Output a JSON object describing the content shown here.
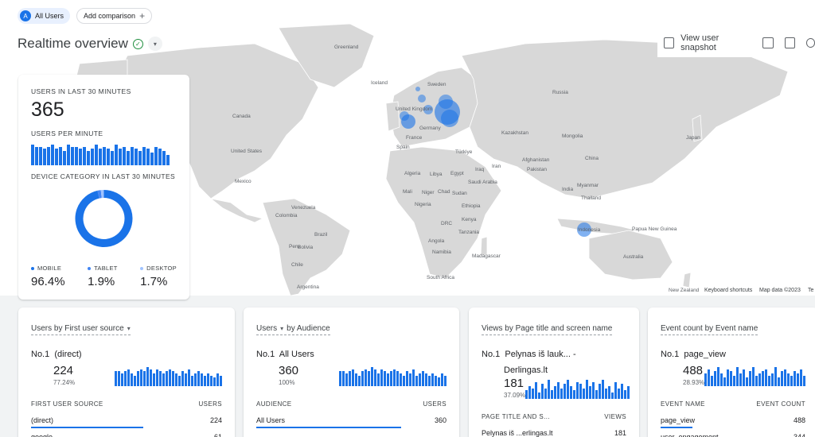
{
  "segment": {
    "badge": "A",
    "label": "All Users",
    "add_label": "Add comparison"
  },
  "header": {
    "title": "Realtime overview",
    "snapshot_label": "View user snapshot"
  },
  "map": {
    "labels": [
      {
        "text": "Greenland"
      },
      {
        "text": "Iceland"
      },
      {
        "text": "Sweden"
      },
      {
        "text": "Russia"
      },
      {
        "text": "United Kingdom"
      },
      {
        "text": "Germany"
      },
      {
        "text": "France"
      },
      {
        "text": "Spain"
      },
      {
        "text": "Kazakhstan"
      },
      {
        "text": "Türkiye"
      },
      {
        "text": "Mongolia"
      },
      {
        "text": "China"
      },
      {
        "text": "Canada"
      },
      {
        "text": "United States"
      },
      {
        "text": "Mexico"
      },
      {
        "text": "Algeria"
      },
      {
        "text": "Libya"
      },
      {
        "text": "Egypt"
      },
      {
        "text": "Mali"
      },
      {
        "text": "Niger"
      },
      {
        "text": "Chad"
      },
      {
        "text": "Sudan"
      },
      {
        "text": "Nigeria"
      },
      {
        "text": "Ethiopia"
      },
      {
        "text": "DRC"
      },
      {
        "text": "Kenya"
      },
      {
        "text": "Tanzania"
      },
      {
        "text": "Angola"
      },
      {
        "text": "Namibia"
      },
      {
        "text": "Madagascar"
      },
      {
        "text": "South Africa"
      },
      {
        "text": "Saudi Arabia"
      },
      {
        "text": "Iran"
      },
      {
        "text": "Iraq"
      },
      {
        "text": "Pakistan"
      },
      {
        "text": "India"
      },
      {
        "text": "Thailand"
      },
      {
        "text": "Indonesia"
      },
      {
        "text": "Papua New Guinea"
      },
      {
        "text": "Australia"
      },
      {
        "text": "New Zealand"
      },
      {
        "text": "Venezuela"
      },
      {
        "text": "Colombia"
      },
      {
        "text": "Peru"
      },
      {
        "text": "Brazil"
      },
      {
        "text": "Bolivia"
      },
      {
        "text": "Chile"
      },
      {
        "text": "Argentina"
      },
      {
        "text": "Japan"
      },
      {
        "text": "Afghanistan"
      },
      {
        "text": "Myanmar"
      }
    ],
    "footer": {
      "shortcuts": "Keyboard shortcuts",
      "data": "Map data ©2023",
      "terms": "Te"
    }
  },
  "overview": {
    "users_caption": "USERS IN LAST 30 MINUTES",
    "users_value": "365",
    "per_minute_caption": "USERS PER MINUTE",
    "per_minute": [
      10,
      9,
      9,
      8,
      9,
      10,
      8,
      9,
      7,
      10,
      9,
      9,
      8,
      9,
      7,
      8,
      10,
      8,
      9,
      8,
      7,
      10,
      8,
      9,
      7,
      9,
      8,
      7,
      9,
      8,
      6,
      9,
      8,
      7,
      5
    ],
    "device_caption": "DEVICE CATEGORY IN LAST 30 MINUTES",
    "devices": [
      {
        "label": "MOBILE",
        "value": "96.4%",
        "fraction": 0.964,
        "color": "#1a73e8"
      },
      {
        "label": "TABLET",
        "value": "1.9%",
        "fraction": 0.019,
        "color": "#4285f4"
      },
      {
        "label": "DESKTOP",
        "value": "1.7%",
        "fraction": 0.017,
        "color": "#a0c3ff"
      }
    ]
  },
  "cards": [
    {
      "title": "Users by First user source",
      "has_dropdown": true,
      "no1_prefix": "No.1",
      "no1_name": "(direct)",
      "value": "224",
      "pct": "77.24%",
      "bars": [
        7,
        7,
        6,
        7,
        8,
        6,
        5,
        7,
        8,
        7,
        9,
        8,
        6,
        8,
        7,
        6,
        7,
        8,
        7,
        6,
        5,
        7,
        6,
        8,
        5,
        6,
        7,
        6,
        5,
        6,
        5,
        4,
        6,
        5
      ],
      "col1": "FIRST USER SOURCE",
      "col2": "USERS",
      "rows": [
        {
          "name": "(direct)",
          "value": "224",
          "share": 0.772
        },
        {
          "name": "google",
          "value": "61",
          "share": 0.21
        }
      ]
    },
    {
      "title": "Users",
      "suffix": "by Audience",
      "has_dropdown": true,
      "no1_prefix": "No.1",
      "no1_name": "All Users",
      "value": "360",
      "pct": "100%",
      "bars": [
        7,
        7,
        6,
        7,
        8,
        6,
        5,
        7,
        8,
        7,
        9,
        8,
        6,
        8,
        7,
        6,
        7,
        8,
        7,
        6,
        5,
        7,
        6,
        8,
        5,
        6,
        7,
        6,
        5,
        6,
        5,
        4,
        6,
        5
      ],
      "col1": "AUDIENCE",
      "col2": "USERS",
      "rows": [
        {
          "name": "All Users",
          "value": "360",
          "share": 1.0
        }
      ]
    },
    {
      "title": "Views by Page title and screen name",
      "has_dropdown": false,
      "no1_prefix": "No.1",
      "no1_name": "Pelynas iš lauk... -",
      "no1_line2": "Derlingas.lt",
      "value": "181",
      "pct": "37.09%",
      "bars": [
        4,
        6,
        5,
        8,
        3,
        7,
        5,
        9,
        4,
        6,
        8,
        5,
        7,
        9,
        6,
        4,
        8,
        7,
        5,
        9,
        6,
        8,
        4,
        7,
        9,
        5,
        6,
        3,
        8,
        5,
        7,
        4,
        6
      ],
      "col1": "PAGE TITLE AND S...",
      "col2": "VIEWS",
      "rows": [
        {
          "name": "Pelynas iš ...erlingas.lt",
          "value": "181",
          "share": 0.37
        }
      ]
    },
    {
      "title": "Event count by Event name",
      "has_dropdown": false,
      "no1_prefix": "No.1",
      "no1_name": "page_view",
      "value": "488",
      "pct": "28.93%",
      "bars": [
        6,
        8,
        5,
        7,
        9,
        6,
        4,
        8,
        7,
        5,
        9,
        6,
        8,
        4,
        7,
        9,
        5,
        6,
        7,
        8,
        5,
        6,
        9,
        4,
        7,
        8,
        6,
        5,
        7,
        6,
        8,
        5
      ],
      "col1": "EVENT NAME",
      "col2": "EVENT COUNT",
      "rows": [
        {
          "name": "page_view",
          "value": "488",
          "share": 0.29
        },
        {
          "name": "user_engagement",
          "value": "344",
          "share": 0.2
        }
      ]
    }
  ]
}
